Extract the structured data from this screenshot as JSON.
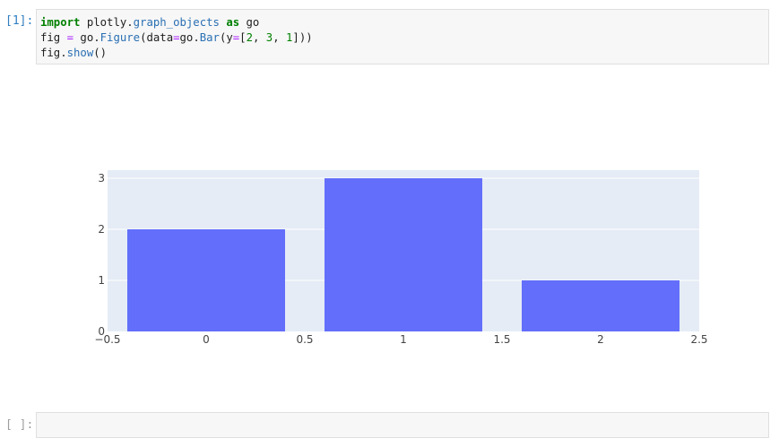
{
  "cells": [
    {
      "prompt": "[1]:",
      "code_lines": [
        [
          {
            "t": "import",
            "c": "kw"
          },
          {
            "t": " plotly",
            "c": ""
          },
          {
            "t": ".",
            "c": ""
          },
          {
            "t": "graph_objects",
            "c": "fn"
          },
          {
            "t": " ",
            "c": ""
          },
          {
            "t": "as",
            "c": "kw"
          },
          {
            "t": " go",
            "c": ""
          }
        ],
        [
          {
            "t": "fig ",
            "c": ""
          },
          {
            "t": "=",
            "c": "op"
          },
          {
            "t": " go.",
            "c": ""
          },
          {
            "t": "Figure",
            "c": "fn"
          },
          {
            "t": "(data",
            "c": ""
          },
          {
            "t": "=",
            "c": "op"
          },
          {
            "t": "go.",
            "c": ""
          },
          {
            "t": "Bar",
            "c": "fn"
          },
          {
            "t": "(y",
            "c": ""
          },
          {
            "t": "=",
            "c": "op"
          },
          {
            "t": "[",
            "c": ""
          },
          {
            "t": "2",
            "c": "num"
          },
          {
            "t": ", ",
            "c": ""
          },
          {
            "t": "3",
            "c": "num"
          },
          {
            "t": ", ",
            "c": ""
          },
          {
            "t": "1",
            "c": "num"
          },
          {
            "t": "]))",
            "c": ""
          }
        ],
        [
          {
            "t": "fig.",
            "c": ""
          },
          {
            "t": "show",
            "c": "fn"
          },
          {
            "t": "()",
            "c": ""
          }
        ]
      ]
    },
    {
      "prompt": "[ ]:",
      "code_lines": []
    }
  ],
  "chart_data": {
    "type": "bar",
    "x": [
      0,
      1,
      2
    ],
    "values": [
      2,
      3,
      1
    ],
    "xlim": [
      -0.5,
      2.5
    ],
    "ylim": [
      0,
      3.15789
    ],
    "x_ticks": [
      -0.5,
      0,
      0.5,
      1,
      1.5,
      2,
      2.5
    ],
    "x_tick_labels": [
      "−0.5",
      "0",
      "0.5",
      "1",
      "1.5",
      "2",
      "2.5"
    ],
    "y_ticks": [
      0,
      1,
      2,
      3
    ],
    "y_tick_labels": [
      "0",
      "1",
      "2",
      "3"
    ],
    "title": "",
    "xlabel": "",
    "ylabel": "",
    "grid": true,
    "colors": {
      "bar": "#636efa",
      "plot_bg": "#e5ecf6",
      "grid": "#ffffff"
    }
  }
}
